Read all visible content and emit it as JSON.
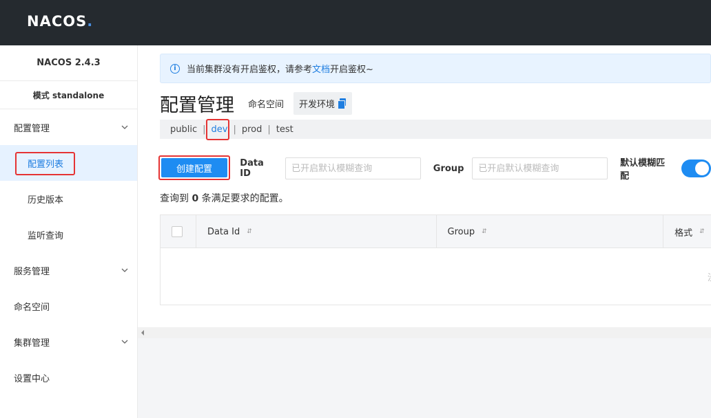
{
  "app": {
    "logo_text_a": "NAC",
    "logo_text_b": "OS",
    "logo_dot": "."
  },
  "sidebar": {
    "version": "NACOS 2.4.3",
    "mode": "模式 standalone",
    "items": [
      {
        "label": "配置管理",
        "type": "group",
        "expanded": true
      },
      {
        "label": "配置列表",
        "type": "sub",
        "active": true
      },
      {
        "label": "历史版本",
        "type": "sub"
      },
      {
        "label": "监听查询",
        "type": "sub"
      },
      {
        "label": "服务管理",
        "type": "group"
      },
      {
        "label": "命名空间",
        "type": "item"
      },
      {
        "label": "集群管理",
        "type": "group"
      },
      {
        "label": "设置中心",
        "type": "item"
      }
    ]
  },
  "notice": {
    "text_before": "当前集群没有开启鉴权，请参考",
    "link": "文档",
    "text_after": "开启鉴权~"
  },
  "header": {
    "title": "配置管理",
    "namespace_label": "命名空间",
    "namespace_value": "开发环境"
  },
  "namespaces": {
    "items": [
      "public",
      "dev",
      "prod",
      "test"
    ],
    "active": "dev"
  },
  "toolbar": {
    "create_label": "创建配置",
    "data_id_label": "Data ID",
    "data_id_placeholder": "已开启默认模糊查询",
    "group_label": "Group",
    "group_placeholder": "已开启默认模糊查询",
    "fuzzy_label": "默认模糊匹配",
    "fuzzy_enabled": true
  },
  "result": {
    "prefix": "查询到",
    "count": "0",
    "suffix": "条满足要求的配置。"
  },
  "table": {
    "columns": [
      "Data Id",
      "Group",
      "格式"
    ],
    "empty_text": "没"
  },
  "colors": {
    "accent": "#1e8cf2",
    "topbar": "#252a2f",
    "highlight": "#e53333"
  }
}
